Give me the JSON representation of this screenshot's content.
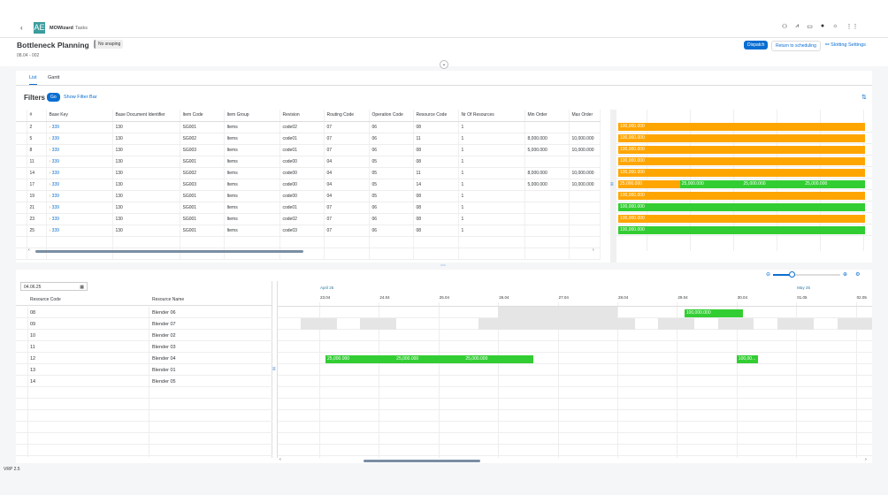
{
  "shell": {
    "back_icon": "chevron-left-icon",
    "logo": "AE",
    "app": "MOWizard",
    "sub": "Tasks",
    "icons": [
      "user-add-icon",
      "chart-icon",
      "monitor-icon",
      "globe-icon",
      "sun-icon",
      "grid-menu-icon"
    ]
  },
  "header": {
    "title": "Bottleneck Planning",
    "badge": "No snaping",
    "subtitle": "08.04 - 002",
    "dispatch": "Dispatch",
    "return": "Return to scheduling",
    "slotting": "Slotting Settings"
  },
  "tabs": [
    {
      "label": "List",
      "active": true
    },
    {
      "label": "Gantt",
      "active": false
    }
  ],
  "filters": {
    "title": "Filters",
    "go": "Go",
    "show": "Show Filter Bar"
  },
  "table": {
    "columns": [
      "#",
      "Base Key",
      "Base Document Identifier",
      "Item Code",
      "Item Group",
      "Revision",
      "Routing Code",
      "Operation Code",
      "Resource Code",
      "Nr Of Resources",
      "Min Order",
      "Max Order"
    ],
    "rows": [
      [
        "2",
        "339",
        "130",
        "SG001",
        "Items",
        "code02",
        "07",
        "06",
        "08",
        "1",
        "",
        ""
      ],
      [
        "5",
        "339",
        "130",
        "SG002",
        "Items",
        "code01",
        "07",
        "06",
        "11",
        "1",
        "8,000.000",
        "10,000.000"
      ],
      [
        "8",
        "339",
        "130",
        "SG003",
        "Items",
        "code01",
        "07",
        "06",
        "08",
        "1",
        "5,000.000",
        "10,000.000"
      ],
      [
        "11",
        "339",
        "130",
        "SG001",
        "Items",
        "code00",
        "04",
        "05",
        "08",
        "1",
        "",
        ""
      ],
      [
        "14",
        "339",
        "130",
        "SG002",
        "Items",
        "code00",
        "04",
        "05",
        "11",
        "1",
        "8,000.000",
        "10,000.000"
      ],
      [
        "17",
        "339",
        "130",
        "SG003",
        "Items",
        "code00",
        "04",
        "05",
        "14",
        "1",
        "5,000.000",
        "10,000.000"
      ],
      [
        "19",
        "339",
        "130",
        "SG001",
        "Items",
        "code00",
        "04",
        "05",
        "08",
        "1",
        "",
        ""
      ],
      [
        "21",
        "339",
        "130",
        "SG001",
        "Items",
        "code01",
        "07",
        "06",
        "08",
        "1",
        "",
        ""
      ],
      [
        "23",
        "339",
        "130",
        "SG001",
        "Items",
        "code02",
        "07",
        "06",
        "08",
        "1",
        "",
        ""
      ],
      [
        "25",
        "339",
        "130",
        "SG001",
        "Items",
        "code03",
        "07",
        "06",
        "08",
        "1",
        "",
        ""
      ]
    ]
  },
  "colors": {
    "orange": "#ffa500",
    "green": "#32cd32",
    "grey": "#e5e5e5",
    "accent": "#0a6ed1"
  },
  "row_bars": [
    [
      {
        "label": "100,000.000",
        "color": "orange"
      }
    ],
    [
      {
        "label": "100,000.000",
        "color": "orange"
      }
    ],
    [
      {
        "label": "100,000.000",
        "color": "orange"
      }
    ],
    [
      {
        "label": "100,000.000",
        "color": "orange"
      }
    ],
    [
      {
        "label": "100,000.000",
        "color": "orange"
      }
    ],
    [
      {
        "label": "25,000.000",
        "color": "orange"
      },
      {
        "label": "25,000.000",
        "color": "green"
      },
      {
        "label": "25,000.000",
        "color": "green"
      },
      {
        "label": "25,000.000",
        "color": "green"
      }
    ],
    [
      {
        "label": "100,000.000",
        "color": "orange"
      }
    ],
    [
      {
        "label": "100,000.000",
        "color": "green"
      }
    ],
    [
      {
        "label": "100,000.000",
        "color": "orange"
      }
    ],
    [
      {
        "label": "100,000.000",
        "color": "green"
      }
    ]
  ],
  "resources": {
    "date": "04.06.25",
    "columns": [
      "Resource Code",
      "Resource Name"
    ],
    "rows": [
      [
        "08",
        "Blender 06"
      ],
      [
        "09",
        "Blender 07"
      ],
      [
        "10",
        "Blender 02"
      ],
      [
        "11",
        "Blender 03"
      ],
      [
        "12",
        "Blender 04"
      ],
      [
        "13",
        "Blender 01"
      ],
      [
        "14",
        "Blender 05"
      ]
    ]
  },
  "timeline": {
    "months": [
      {
        "label": "April 25",
        "date": "2025-04-23"
      },
      {
        "label": "May 25",
        "date": "2025-05-01"
      }
    ],
    "days": [
      "23.04",
      "24.04",
      "25.04",
      "26.04",
      "27.04",
      "28.04",
      "29.04",
      "30.04",
      "01.05",
      "02.05"
    ],
    "bars": [
      {
        "row": 0,
        "start": "2025-04-26T00:00",
        "end": "2025-04-28T00:00",
        "color": "grey",
        "label": ""
      },
      {
        "row": 0,
        "start": "2025-04-29T03:00",
        "end": "2025-04-30T02:30",
        "color": "green",
        "label": "100,000.000"
      },
      {
        "row": 1,
        "start": "2025-04-22T16:30",
        "end": "2025-04-23T07:00",
        "color": "grey",
        "label": ""
      },
      {
        "row": 1,
        "start": "2025-04-23T16:30",
        "end": "2025-04-24T07:00",
        "color": "grey",
        "label": ""
      },
      {
        "row": 1,
        "start": "2025-04-25T16:00",
        "end": "2025-04-28T07:00",
        "color": "grey",
        "label": ""
      },
      {
        "row": 1,
        "start": "2025-04-28T16:30",
        "end": "2025-04-29T07:00",
        "color": "grey",
        "label": ""
      },
      {
        "row": 1,
        "start": "2025-04-29T16:30",
        "end": "2025-04-30T07:00",
        "color": "grey",
        "label": ""
      },
      {
        "row": 1,
        "start": "2025-04-30T16:30",
        "end": "2025-05-01T07:00",
        "color": "grey",
        "label": ""
      },
      {
        "row": 1,
        "start": "2025-05-01T16:30",
        "end": "2025-05-02T09:00",
        "color": "grey",
        "label": ""
      },
      {
        "row": 4,
        "start": "2025-04-23T02:30",
        "end": "2025-04-24T06:20",
        "color": "green",
        "label": "25,000.000"
      },
      {
        "row": 4,
        "start": "2025-04-24T06:20",
        "end": "2025-04-25T10:10",
        "color": "green",
        "label": "25,000.000"
      },
      {
        "row": 4,
        "start": "2025-04-25T10:10",
        "end": "2025-04-26T14:00",
        "color": "green",
        "label": "25,000.000"
      },
      {
        "row": 4,
        "start": "2025-04-30T00:00",
        "end": "2025-04-30T08:40",
        "color": "green",
        "label": "100,00..."
      }
    ]
  },
  "footer": "VRP 2.5"
}
